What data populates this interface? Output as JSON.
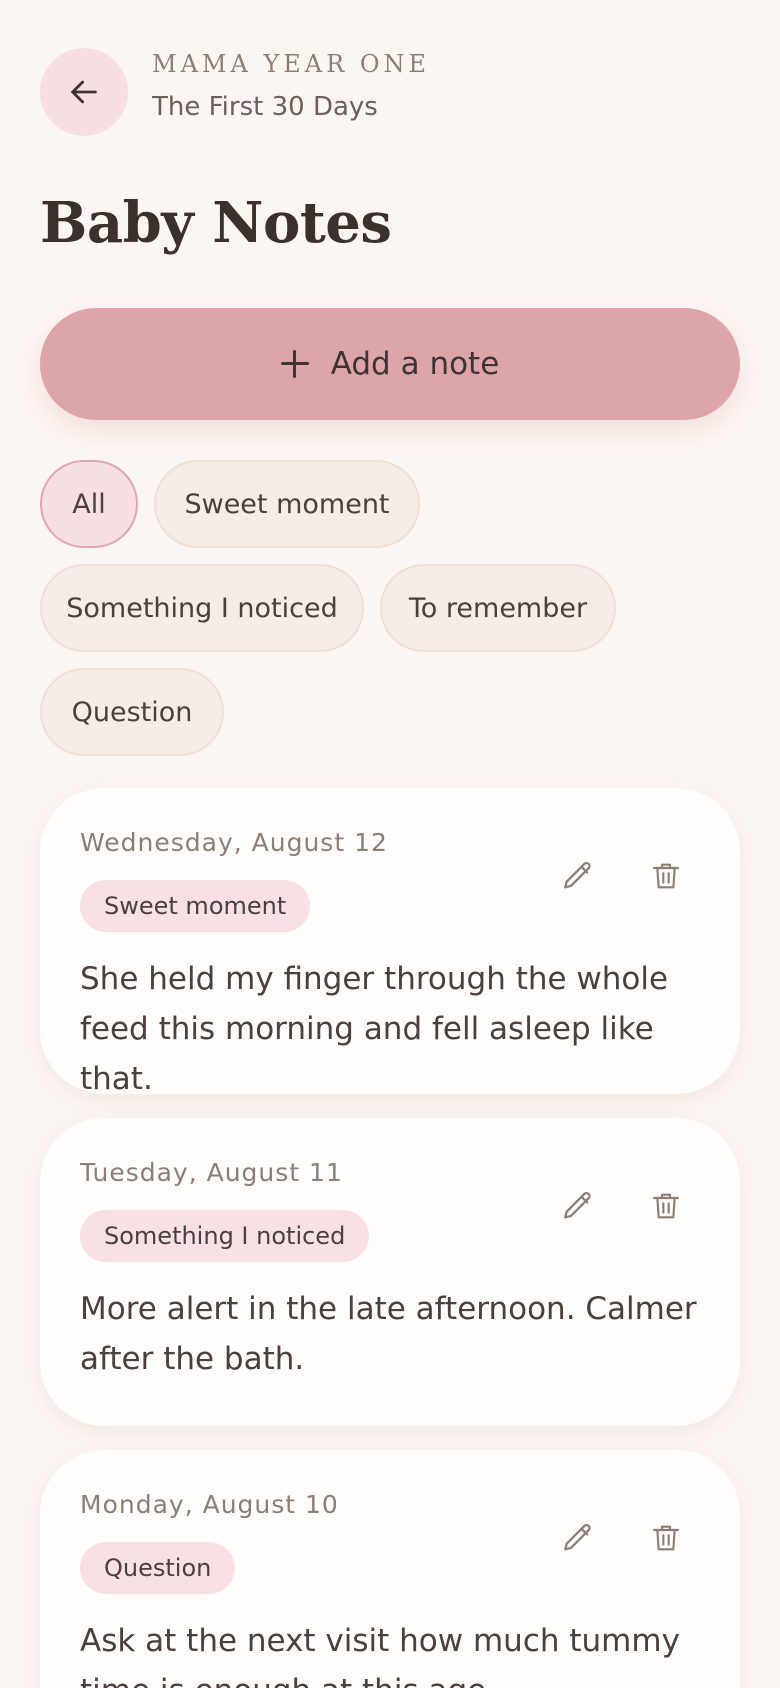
{
  "header": {
    "app_name": "MAMA YEAR ONE",
    "subtitle": "The First 30 Days",
    "back_icon": "arrow-left-icon"
  },
  "page": {
    "title": "Baby Notes"
  },
  "add_button": {
    "label": "Add a note",
    "icon": "plus-icon"
  },
  "filters": [
    {
      "label": "All",
      "active": true
    },
    {
      "label": "Sweet moment",
      "active": false
    },
    {
      "label": "Something I noticed",
      "active": false
    },
    {
      "label": "To remember",
      "active": false
    },
    {
      "label": "Question",
      "active": false
    }
  ],
  "notes": [
    {
      "date": "Wednesday, August 12",
      "tag": "Sweet moment",
      "text": "She held my finger through the whole feed this morning and fell asleep like that."
    },
    {
      "date": "Tuesday, August 11",
      "tag": "Something I noticed",
      "text": "More alert in the late afternoon. Calmer after the bath."
    },
    {
      "date": "Monday, August 10",
      "tag": "Question",
      "text": "Ask at the next visit how much tummy time is enough at this age."
    }
  ],
  "colors": {
    "background": "#fcf6f2",
    "accent": "#dda5a9",
    "tag_bg": "#f9e1e3",
    "card_bg": "#fffdfb",
    "text": "#3e3532"
  }
}
